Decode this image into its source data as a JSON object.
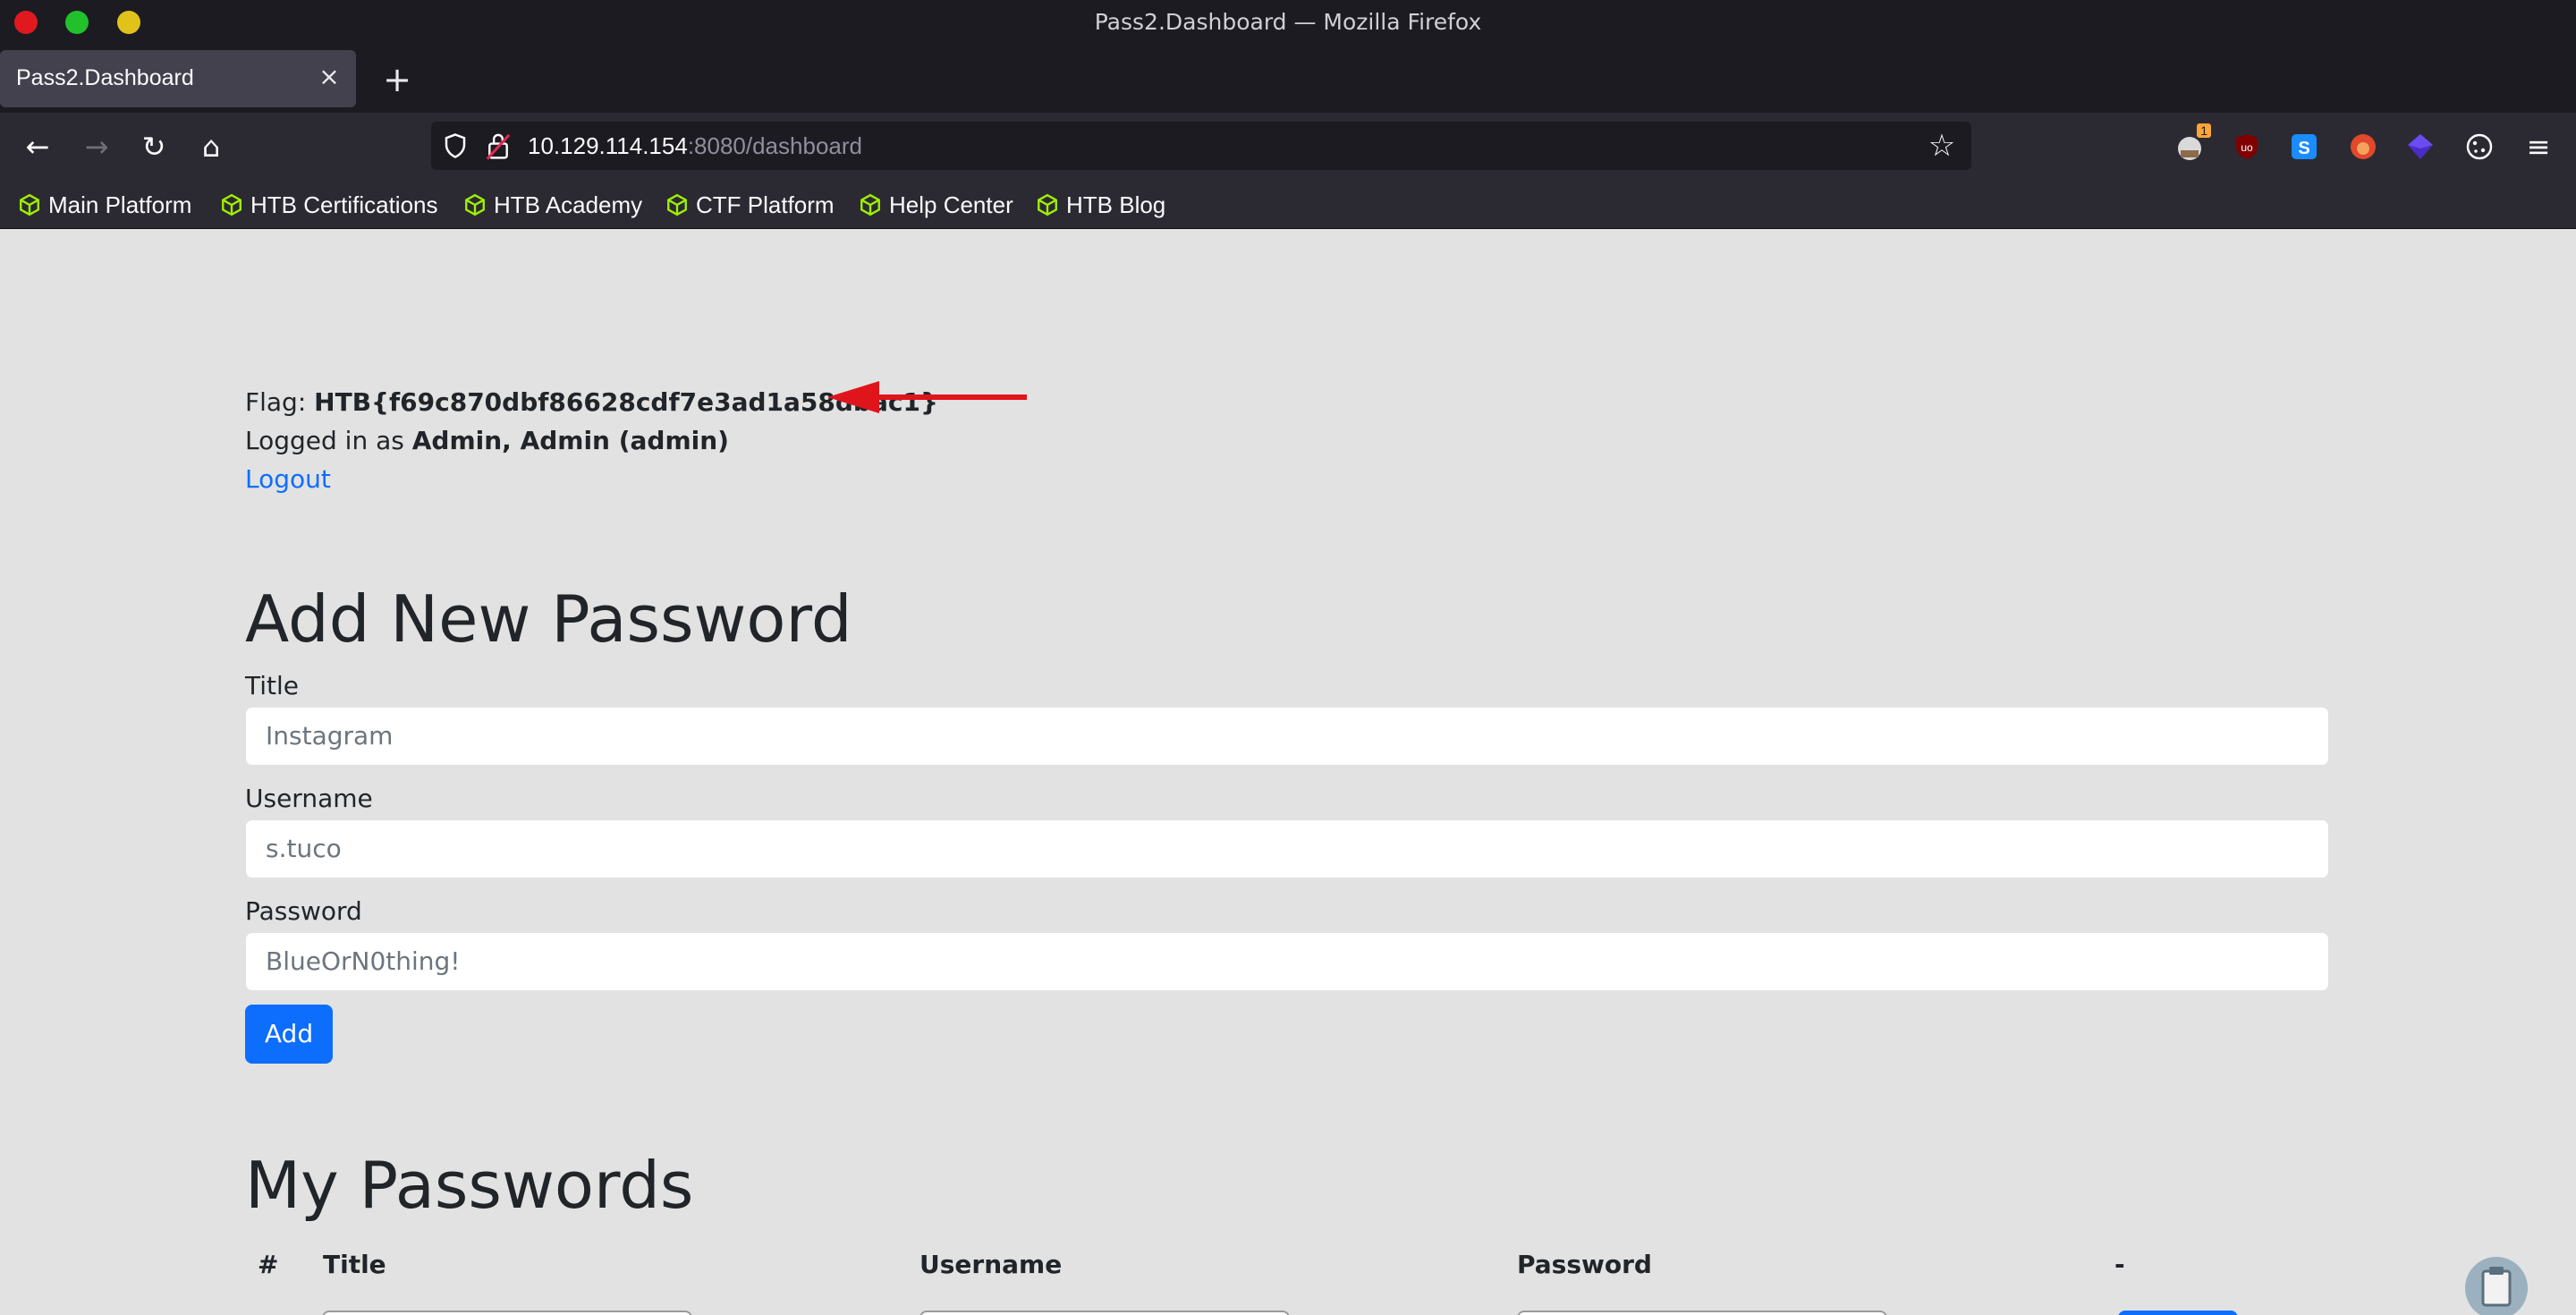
{
  "window": {
    "title": "Pass2.Dashboard — Mozilla Firefox"
  },
  "tabs": [
    {
      "title": "Pass2.Dashboard",
      "close": "×"
    }
  ],
  "new_tab": "+",
  "nav": {
    "back": "←",
    "forward": "→",
    "reload": "↻",
    "home": "⌂",
    "url_host": "10.129.114.154",
    "url_path": ":8080/dashboard",
    "bookmark_star": "☆",
    "menu": "≡"
  },
  "extensions": {
    "badge_count": "1"
  },
  "bookmarks": [
    {
      "label": "Main Platform"
    },
    {
      "label": "HTB Certifications"
    },
    {
      "label": "HTB Academy"
    },
    {
      "label": "CTF Platform"
    },
    {
      "label": "Help Center"
    },
    {
      "label": "HTB Blog"
    }
  ],
  "page": {
    "flag_prefix": "Flag: ",
    "flag_value": "HTB{f69c870dbf86628cdf7e3ad1a58dbac1}",
    "logged_prefix": "Logged in as ",
    "logged_user": "Admin, Admin (admin)",
    "logout": "Logout",
    "add_heading": "Add New Password",
    "form": {
      "title_label": "Title",
      "title_value": "Instagram",
      "username_label": "Username",
      "username_value": "s.tuco",
      "password_label": "Password",
      "password_value": "BlueOrN0thing!",
      "add_button": "Add"
    },
    "list_heading": "My Passwords",
    "table_headers": [
      "#",
      "Title",
      "Username",
      "Password",
      "-"
    ]
  },
  "colors": {
    "accent": "#0d6efd",
    "annotation_arrow": "#e0141b",
    "bookmark_icon": "#9fef00",
    "page_background": "#e2e2e2"
  }
}
